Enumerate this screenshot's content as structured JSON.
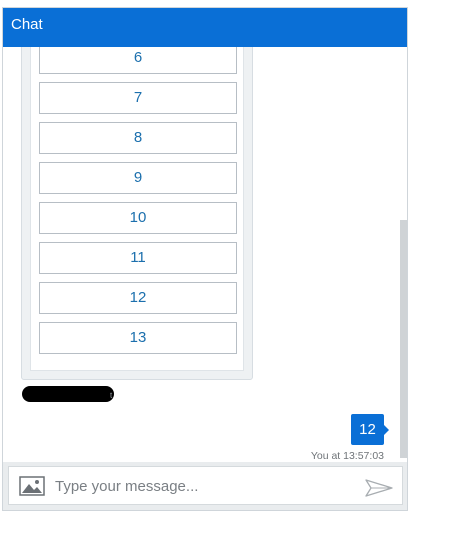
{
  "header": {
    "title": "Chat"
  },
  "options": [
    "6",
    "7",
    "8",
    "9",
    "10",
    "11",
    "12",
    "13"
  ],
  "user_message": {
    "text": "12",
    "timestamp": "You at 13:57:03"
  },
  "redacted_tail": "t",
  "composer": {
    "placeholder": "Type your message..."
  },
  "colors": {
    "header": "#0a6fd6",
    "bubble": "#0a6fd6",
    "option_text": "#1b6fad"
  },
  "icons": {
    "image": "image-icon",
    "send": "send-icon"
  }
}
